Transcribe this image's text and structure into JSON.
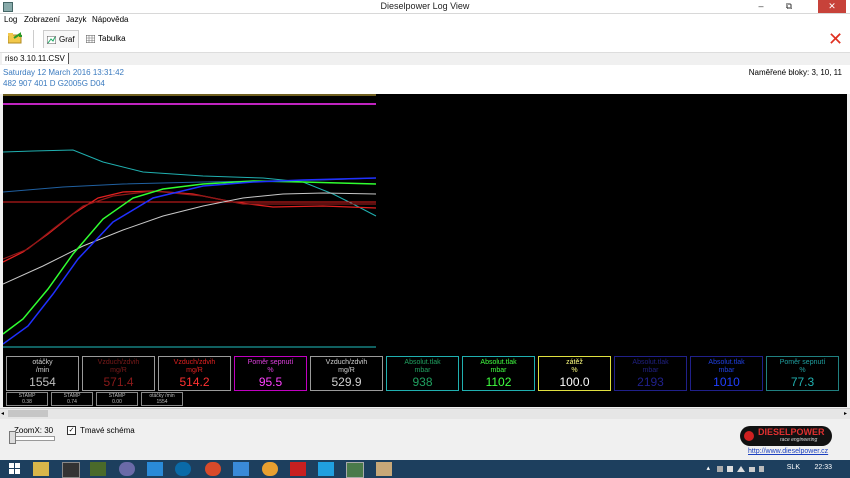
{
  "window": {
    "title": "Dieselpower Log View",
    "minimize": "–",
    "maximize": "⧉",
    "close": "✕"
  },
  "menu": [
    "Log",
    "Zobrazení",
    "Jazyk",
    "Nápověda"
  ],
  "toolbar": {
    "graf_label": "Graf",
    "tabulka_label": "Tabulka",
    "close_x": "✕"
  },
  "file_tab": "riso 3.10.11.CSV",
  "info": {
    "date": "Saturday 12 March 2016 13:31:42",
    "vehicle": "482 907 401 D  G2005G D04",
    "blocks": "Naměřené bloky: 3, 10, 11"
  },
  "gauges": [
    {
      "name": "otáčky",
      "unit": "/min",
      "value": "1554",
      "color": "#9a9a9a",
      "textcolor": "#cfcfcf",
      "valcolor": "#bfbfbf"
    },
    {
      "name": "Vzduch/zdvih",
      "unit": "mg/R",
      "value": "571.4",
      "color": "#9a9a9a",
      "textcolor": "#7a1a1a",
      "valcolor": "#8a1a1a"
    },
    {
      "name": "Vzduch/zdvih",
      "unit": "mg/R",
      "value": "514.2",
      "color": "#9a9a9a",
      "textcolor": "#e02020",
      "valcolor": "#ff3030"
    },
    {
      "name": "Poměr sepnutí",
      "unit": "%",
      "value": "95.5",
      "color": "#c000c0",
      "textcolor": "#e040e0",
      "valcolor": "#ff40ff"
    },
    {
      "name": "Vzduch/zdvih",
      "unit": "mg/R",
      "value": "529.9",
      "color": "#9a9a9a",
      "textcolor": "#cfcfcf",
      "valcolor": "#d0d0d0"
    },
    {
      "name": "Absolut.tlak",
      "unit": "mbar",
      "value": "938",
      "color": "#20b0b0",
      "textcolor": "#20a060",
      "valcolor": "#20a060"
    },
    {
      "name": "Absolut.tlak",
      "unit": "mbar",
      "value": "1102",
      "color": "#20b0b0",
      "textcolor": "#40ff40",
      "valcolor": "#40ff40"
    },
    {
      "name": "zátěž",
      "unit": "%",
      "value": "100.0",
      "color": "#e0e040",
      "textcolor": "#ffff80",
      "valcolor": "#ffffff"
    },
    {
      "name": "Absolut.tlak",
      "unit": "mbar",
      "value": "2193",
      "color": "#20208a",
      "textcolor": "#202080",
      "valcolor": "#20208a"
    },
    {
      "name": "Absolut.tlak",
      "unit": "mbar",
      "value": "1010",
      "color": "#20208a",
      "textcolor": "#2040e0",
      "valcolor": "#2040ff"
    },
    {
      "name": "Poměr sepnutí",
      "unit": "%",
      "value": "77.3",
      "color": "#208080",
      "textcolor": "#20a0a0",
      "valcolor": "#20b0b0"
    }
  ],
  "mini_gauges": [
    {
      "name": "STAMP",
      "value": "0.38"
    },
    {
      "name": "STAMP",
      "value": "0.74"
    },
    {
      "name": "STAMP",
      "value": "0.00"
    },
    {
      "name": "otáčky /min",
      "value": "1554"
    }
  ],
  "bottom": {
    "zoom_label": "ZoomX: 30",
    "dark_scheme_label": "Tmavé schéma",
    "dark_scheme_checked": true,
    "logo_main": "DIESELPOWER",
    "logo_sub": "race engineering",
    "link": "http://www.dieselpower.cz"
  },
  "taskbar": {
    "lang": "SLK",
    "time": "22:33"
  },
  "series_colors": {
    "cyan": "#20c0c0",
    "blue": "#2030ff",
    "red": "#e02020",
    "darkred": "#901818",
    "green": "#30ff30",
    "white": "#c8c8c8",
    "yellow": "#ffff40",
    "magenta": "#ff30ff",
    "olive": "#b0b050"
  }
}
